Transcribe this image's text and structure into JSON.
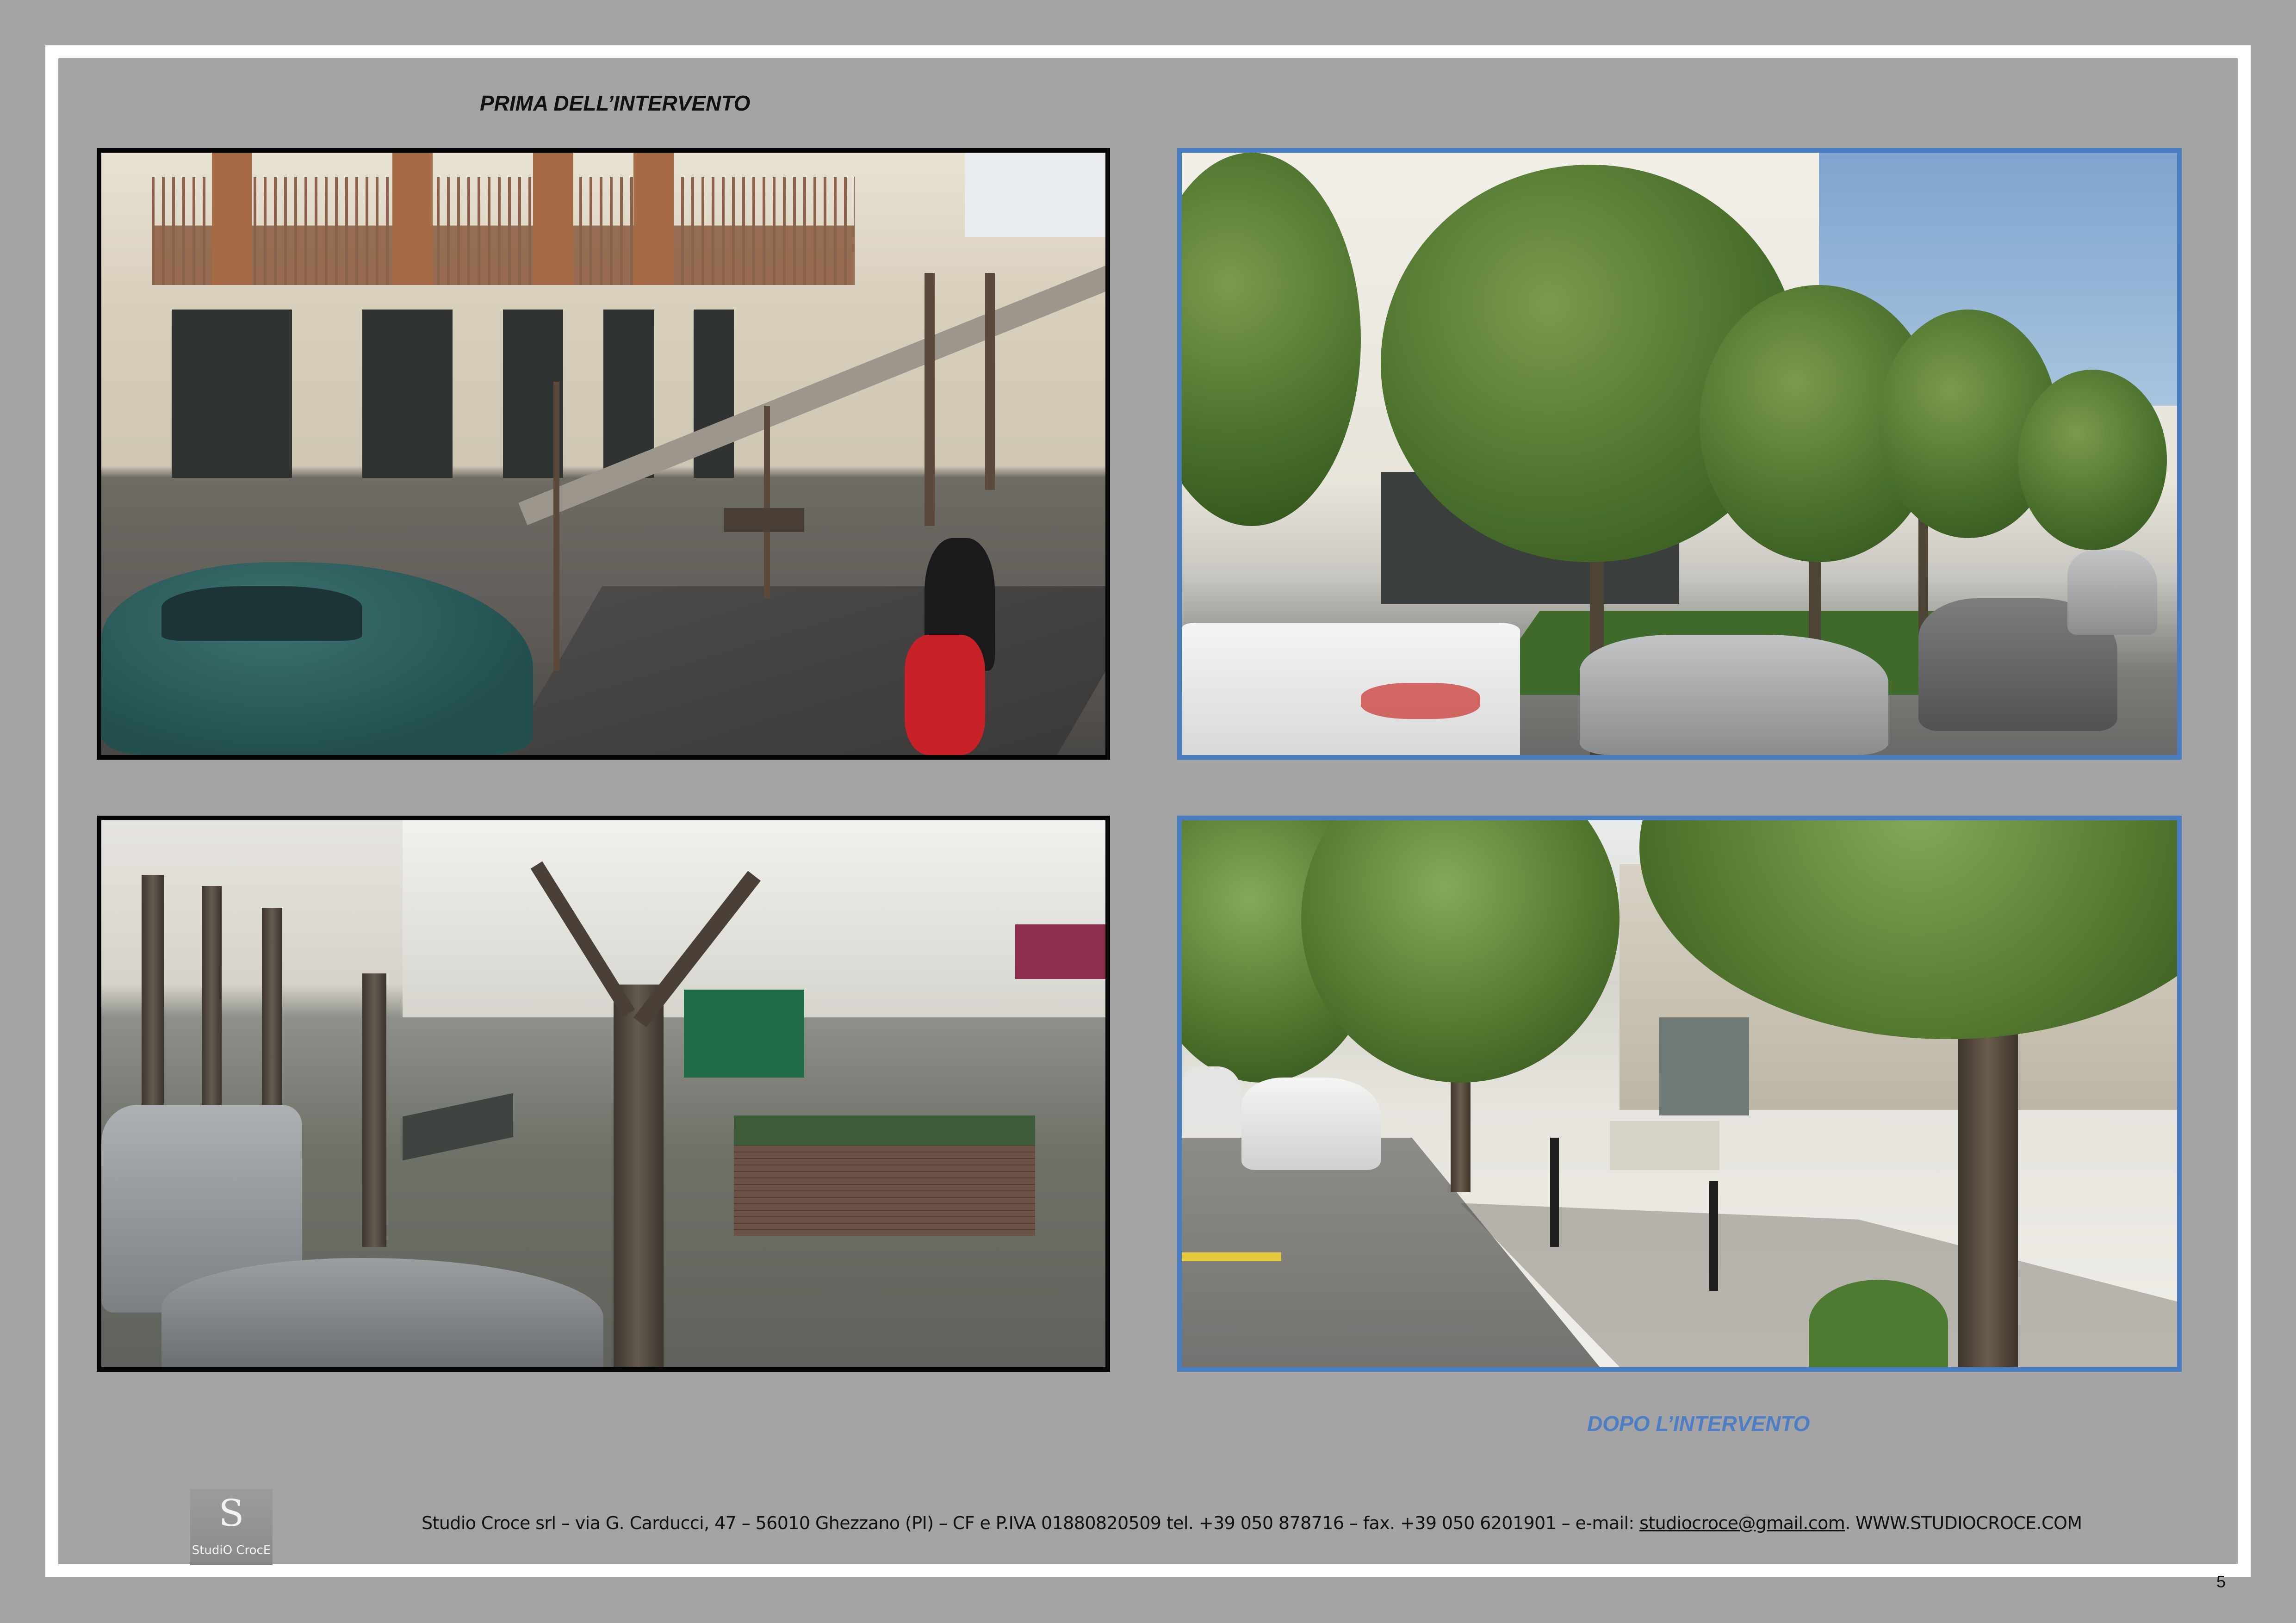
{
  "section_titles": {
    "before": "PRIMA DELL’INTERVENTO",
    "after": "DOPO L’INTERVENTO"
  },
  "colors": {
    "page_background": "#a4a4a4",
    "frame": "#ffffff",
    "before_border": "#050505",
    "after_border": "#4a7cc2",
    "after_title": "#4d7ec5"
  },
  "logo": {
    "mark": "S",
    "text": "StudiO CrocE"
  },
  "footer": {
    "text_before": "Studio Croce srl – via G. Carducci, 47 – 56010 Ghezzano (PI) – CF e P.IVA 01880820509 tel. +39 050 878716 – fax. +39 050 6201901 – e-mail: ",
    "email": "studiocroce@gmail.com",
    "text_after": ". WWW.STUDIOCROCE.COM"
  },
  "page_number": "5"
}
